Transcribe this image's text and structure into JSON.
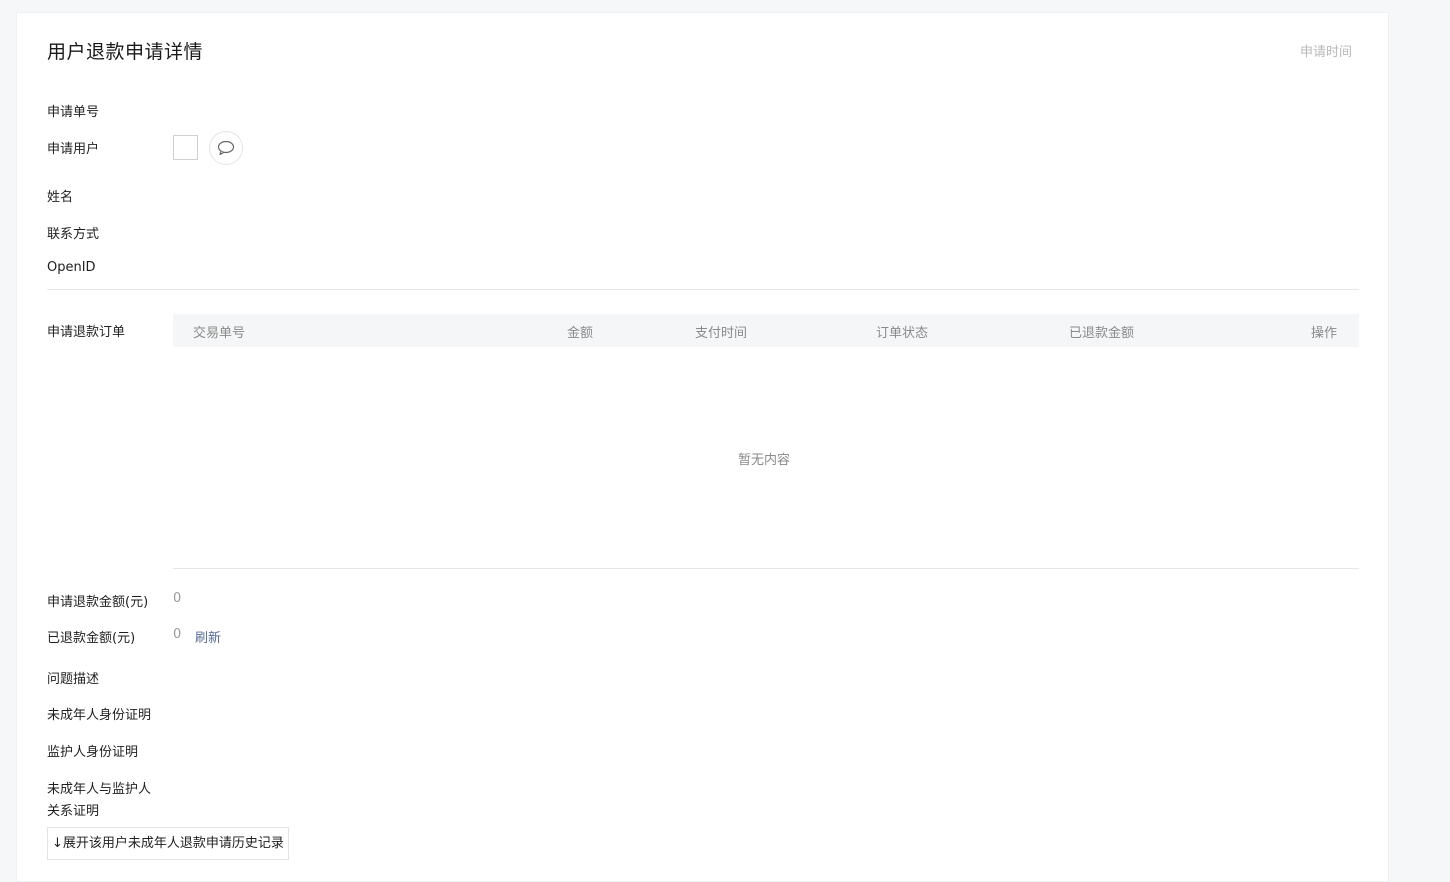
{
  "header": {
    "title": "用户退款申请详情",
    "apply_time_label": "申请时间"
  },
  "user_info": {
    "application_no_label": "申请单号",
    "applicant_label": "申请用户",
    "name_label": "姓名",
    "contact_label": "联系方式",
    "openid_label": "OpenID"
  },
  "orders": {
    "section_label": "申请退款订单",
    "columns": [
      "交易单号",
      "金额",
      "支付时间",
      "订单状态",
      "已退款金额",
      "操作"
    ],
    "rows": [],
    "empty_text": "暂无内容"
  },
  "amounts": {
    "requested_label": "申请退款金额(元)",
    "requested_value": "0",
    "refunded_label": "已退款金额(元)",
    "refunded_value": "0",
    "refresh_label": "刷新"
  },
  "documents": {
    "problem_label": "问题描述",
    "minor_id_label": "未成年人身份证明",
    "guardian_id_label": "监护人身份证明",
    "relation_label_line1": "未成年人与监护人",
    "relation_label_line2": "关系证明"
  },
  "history": {
    "expand_label": "↓展开该用户未成年人退款申请历史记录"
  }
}
